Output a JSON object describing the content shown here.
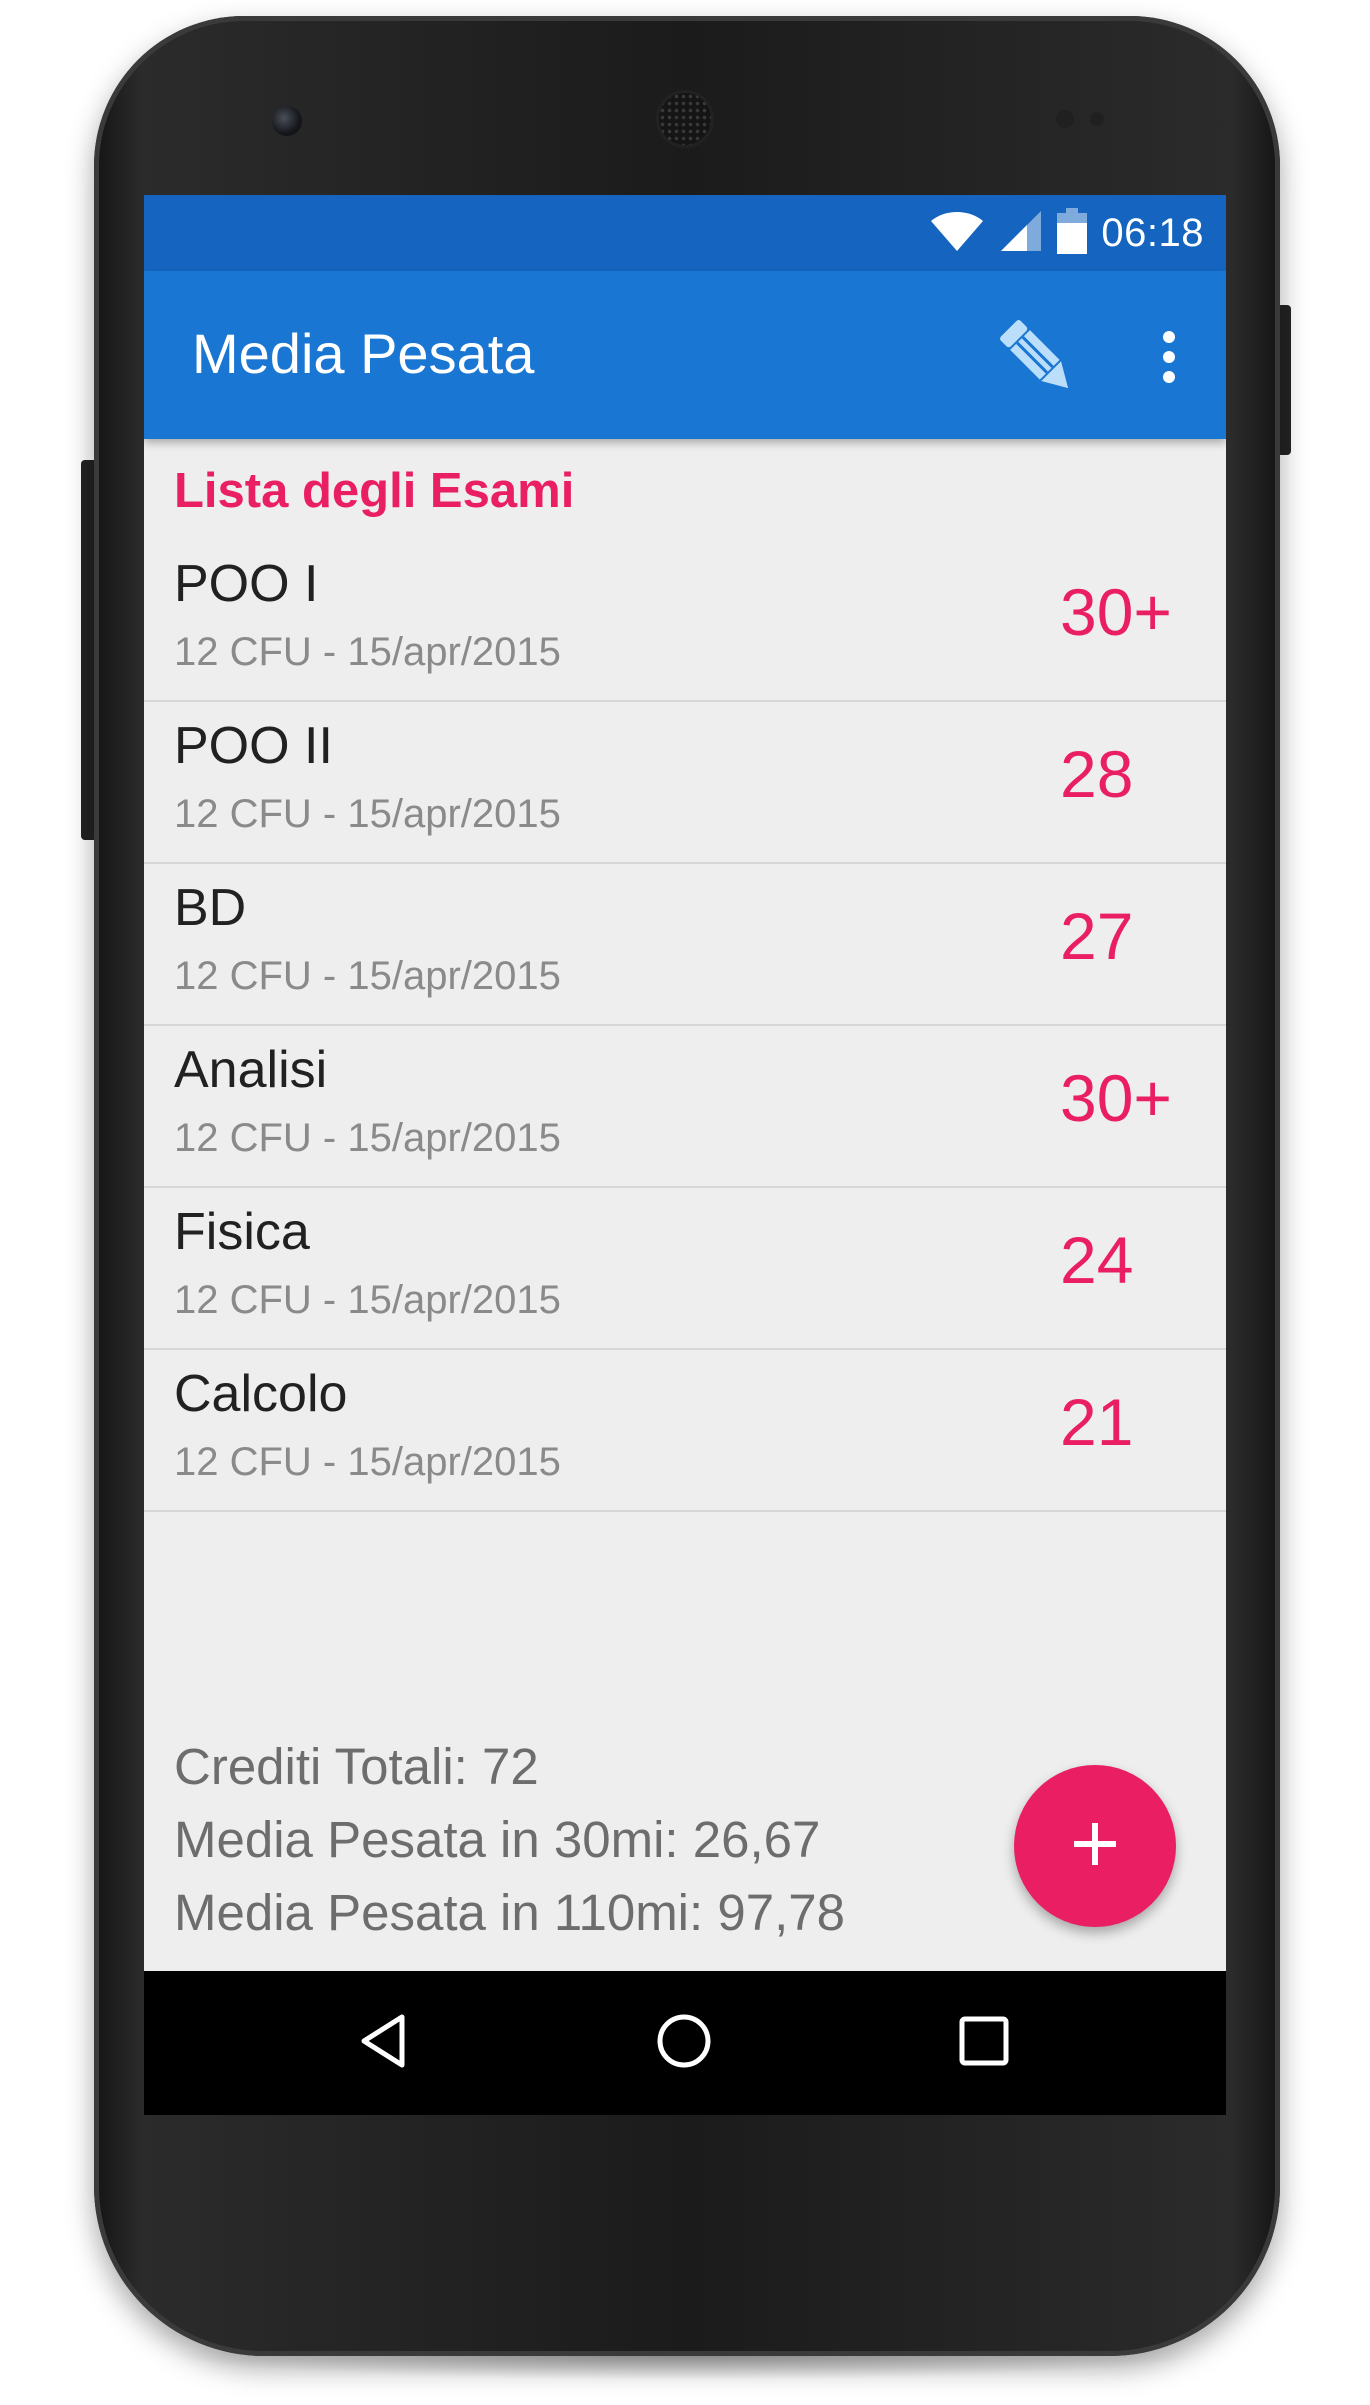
{
  "status_bar": {
    "time": "06:18",
    "icons": [
      "wifi-icon",
      "signal-icon",
      "battery-icon"
    ]
  },
  "app_bar": {
    "title": "Media Pesata",
    "actions": [
      "pencil-icon",
      "more-vert-icon"
    ]
  },
  "section_header": "Lista degli Esami",
  "exams": [
    {
      "name": "POO I",
      "meta": "12 CFU - 15/apr/2015",
      "grade": "30+"
    },
    {
      "name": "POO II",
      "meta": "12 CFU - 15/apr/2015",
      "grade": "28"
    },
    {
      "name": "BD",
      "meta": "12 CFU - 15/apr/2015",
      "grade": "27"
    },
    {
      "name": "Analisi",
      "meta": "12 CFU - 15/apr/2015",
      "grade": "30+"
    },
    {
      "name": "Fisica",
      "meta": "12 CFU - 15/apr/2015",
      "grade": "24"
    },
    {
      "name": "Calcolo",
      "meta": "12 CFU - 15/apr/2015",
      "grade": "21"
    }
  ],
  "summary": {
    "total_credits": "Crediti Totali: 72",
    "avg_30": "Media Pesata in 30mi: 26,67",
    "avg_110": "Media Pesata in 110mi: 97,78"
  },
  "fab": {
    "icon": "add-icon"
  },
  "nav_bar": {
    "icons": [
      "back-icon",
      "home-icon",
      "recents-icon"
    ]
  },
  "colors": {
    "status_bar": "#1565c0",
    "app_bar": "#1976d2",
    "accent": "#e91e63",
    "background": "#eeeeee"
  }
}
